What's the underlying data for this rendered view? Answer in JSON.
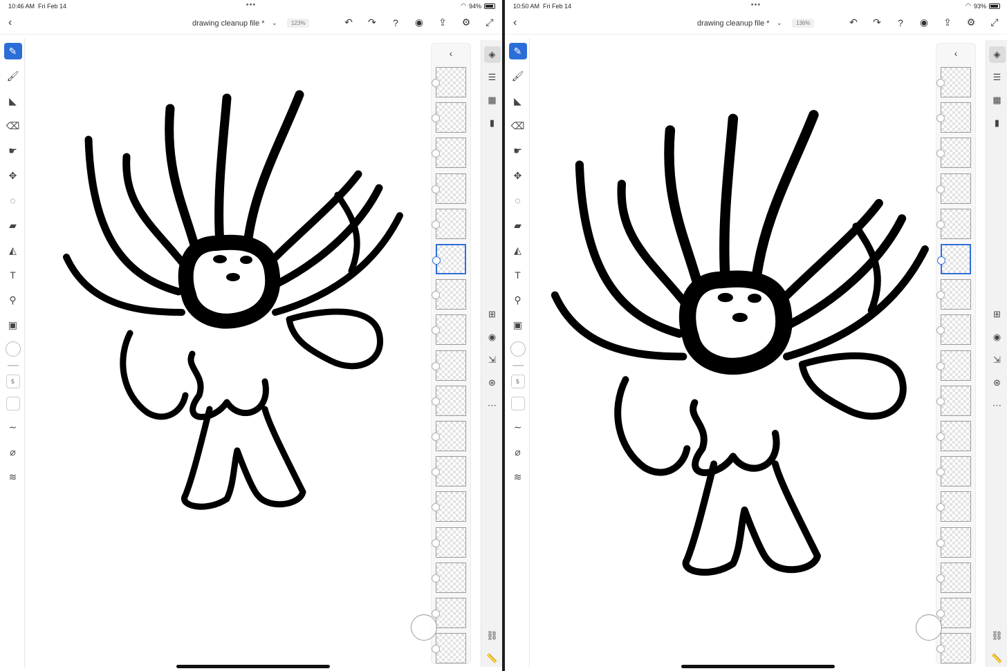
{
  "panes": [
    {
      "status": {
        "time": "10:46 AM",
        "date": "Fri Feb 14",
        "battery": "94%",
        "multitask": "•••"
      },
      "doc": {
        "title": "drawing cleanup file *",
        "zoom": "123%",
        "chevron": "⌄"
      },
      "selected_layer_index": 5
    },
    {
      "status": {
        "time": "10:50 AM",
        "date": "Fri Feb 14",
        "battery": "93%",
        "multitask": "•••"
      },
      "doc": {
        "title": "drawing cleanup file *",
        "zoom": "136%",
        "chevron": "⌄"
      },
      "selected_layer_index": 5
    }
  ],
  "toolbar": {
    "brush_size": "5",
    "tools": [
      "pixel-brush",
      "live-brush",
      "fill-brush",
      "eraser",
      "smudge",
      "move",
      "lasso",
      "paint-bucket",
      "shape",
      "text",
      "eyedropper",
      "image",
      "color",
      "size",
      "flow",
      "smoothing",
      "pressure",
      "settings"
    ]
  },
  "layers": {
    "count": 17,
    "collapse_glyph": "‹"
  },
  "top_actions": [
    "undo",
    "redo",
    "help",
    "profile",
    "share",
    "settings",
    "fullscreen"
  ],
  "properties_rail": [
    "layers",
    "adjustments",
    "grid",
    "comment",
    "add-layer",
    "visibility",
    "move-to",
    "blend",
    "more"
  ],
  "icons": {
    "back": "‹",
    "undo": "↶",
    "redo": "↷",
    "help": "?",
    "profile": "◉",
    "share": "⇪",
    "settings": "⚙",
    "fullscreen": "⤢"
  },
  "colors": {
    "accent": "#2c6ed8",
    "ink": "#000000"
  }
}
